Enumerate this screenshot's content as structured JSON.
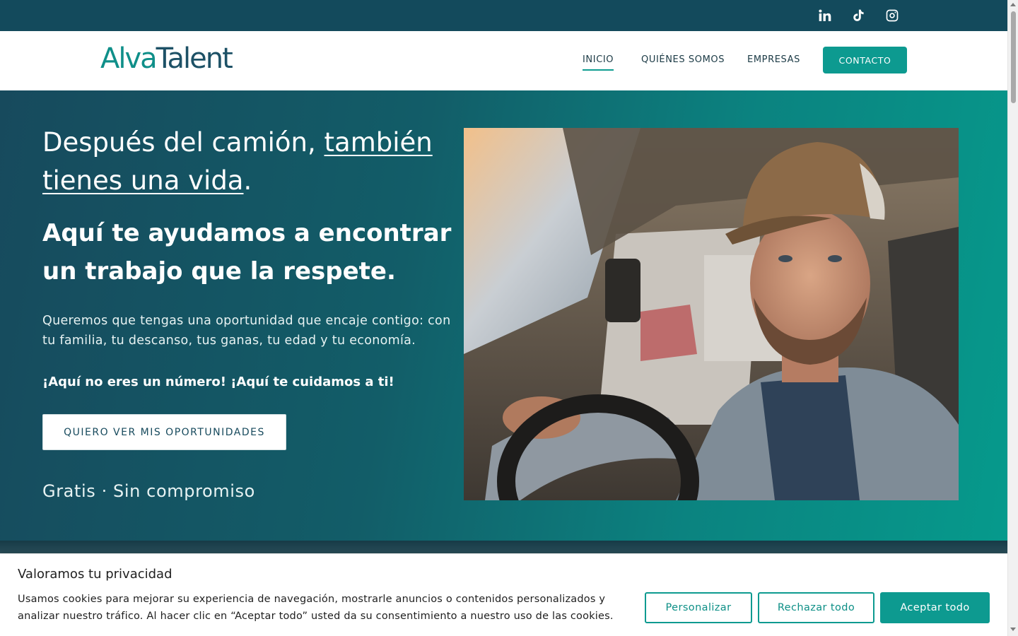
{
  "social": {
    "icons": [
      "linkedin-icon",
      "tiktok-icon",
      "instagram-icon"
    ]
  },
  "header": {
    "logo": {
      "part1": "Alva",
      "part2": "Talent"
    },
    "nav": {
      "inicio": "INICIO",
      "quienes": "QUIÉNES SOMOS",
      "empresas": "EMPRESAS",
      "contacto": "CONTACTO"
    }
  },
  "hero": {
    "title_plain": "Después del camión, ",
    "title_underlined": "también tienes una vida",
    "title_end": ".",
    "subtitle": "Aquí te ayudamos a encontrar un trabajo que la respete.",
    "description": "Queremos que tengas una oportunidad que encaje contigo: con tu familia, tu descanso, tus ganas, tu edad y tu economía.",
    "highlight": "¡Aquí no eres un número! ¡Aquí te cuidamos a ti!",
    "cta": "QUIERO VER MIS OPORTUNIDADES",
    "note": "Gratis · Sin compromiso"
  },
  "cookie": {
    "title": "Valoramos tu privacidad",
    "text": "Usamos cookies para mejorar su experiencia de navegación, mostrarle anuncios o contenidos personalizados y analizar nuestro tráfico. Al hacer clic en “Aceptar todo” usted da su consentimiento a nuestro uso de las cookies.",
    "personalizar": "Personalizar",
    "rechazar": "Rechazar todo",
    "aceptar": "Aceptar todo"
  },
  "colors": {
    "brand_teal": "#0d9a90",
    "brand_dark": "#134a5c",
    "white": "#ffffff"
  }
}
